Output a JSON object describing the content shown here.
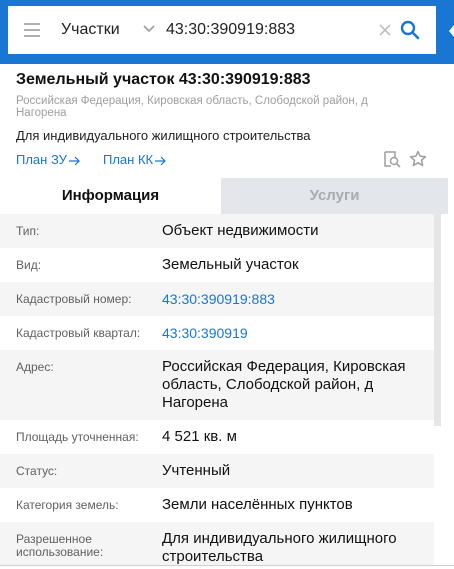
{
  "search": {
    "type_label": "Участки",
    "query": "43:30:390919:883"
  },
  "card": {
    "title": "Земельный участок 43:30:390919:883",
    "address": "Российская Федерация, Кировская область, Слободской район, д Нагорена",
    "purpose": "Для индивидуального жилищного строительства",
    "links": {
      "plan_zu": "План ЗУ",
      "plan_kk": "План КК"
    }
  },
  "tabs": {
    "info": "Информация",
    "services": "Услуги"
  },
  "rows": [
    {
      "label": "Тип:",
      "value": "Объект недвижимости"
    },
    {
      "label": "Вид:",
      "value": "Земельный участок"
    },
    {
      "label": "Кадастровый номер:",
      "value": "43:30:390919:883"
    },
    {
      "label": "Кадастровый квартал:",
      "value": "43:30:390919"
    },
    {
      "label": "Адрес:",
      "value": "Российская Федерация, Кировская область, Слободской район, д Нагорена"
    },
    {
      "label": "Площадь уточненная:",
      "value": "4 521 кв. м"
    },
    {
      "label": "Статус:",
      "value": "Учтенный"
    },
    {
      "label": "Категория земель:",
      "value": "Земли населённых пунктов"
    },
    {
      "label": "Разрешенное использование:",
      "value": "Для индивидуального жилищного строительства"
    }
  ],
  "colors": {
    "brand": "#1976d2",
    "link": "#1976d2",
    "tab_inactive_bg": "#e3e6ea"
  },
  "icons": [
    "menu-icon",
    "chevron-down-icon",
    "clear-icon",
    "search-icon",
    "arrow-right-icon",
    "document-search-icon",
    "star-icon"
  ]
}
